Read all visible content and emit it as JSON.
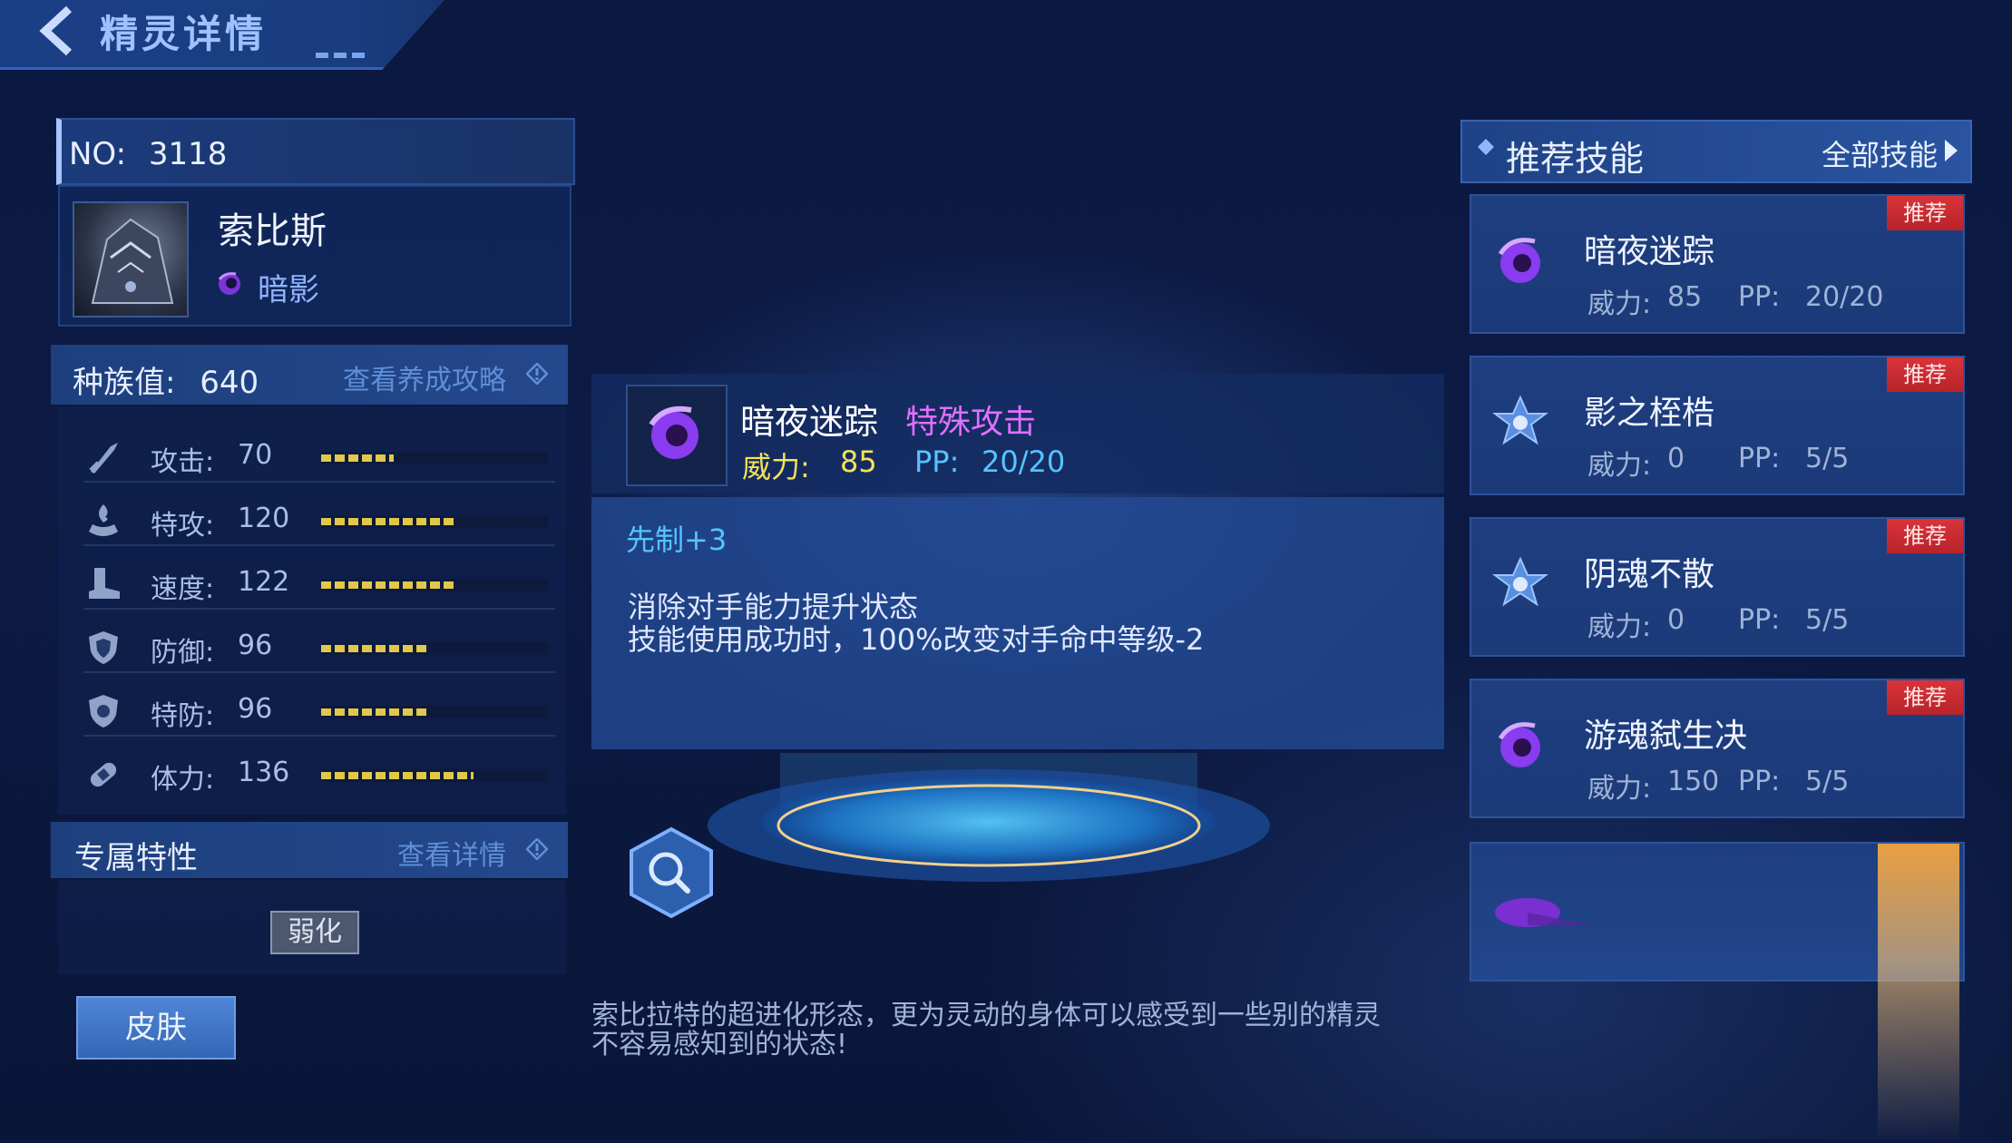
{
  "header": {
    "title": "精灵详情"
  },
  "sprite": {
    "no_label": "NO:",
    "no_value": "3118",
    "name": "索比斯",
    "type": "暗影"
  },
  "stats": {
    "total_label": "种族值:",
    "total_value": "640",
    "guide_link": "查看养成攻略",
    "items": [
      {
        "label": "攻击:",
        "value": "70",
        "fill": 0.32,
        "icon": "sword-icon"
      },
      {
        "label": "特攻:",
        "value": "120",
        "fill": 0.59,
        "icon": "fire-hand-icon"
      },
      {
        "label": "速度:",
        "value": "122",
        "fill": 0.6,
        "icon": "boot-icon"
      },
      {
        "label": "防御:",
        "value": "96",
        "fill": 0.47,
        "icon": "shield-icon"
      },
      {
        "label": "特防:",
        "value": "96",
        "fill": 0.47,
        "icon": "special-shield-icon"
      },
      {
        "label": "体力:",
        "value": "136",
        "fill": 0.67,
        "icon": "bandage-icon"
      }
    ]
  },
  "trait": {
    "title": "专属特性",
    "link": "查看详情",
    "badge": "弱化"
  },
  "skin_button": "皮肤",
  "detail": {
    "name": "暗夜迷踪",
    "category": "特殊攻击",
    "power_label": "威力:",
    "power_value": "85",
    "pp_label": "PP:",
    "pp_value": "20/20",
    "priority": "先制+3",
    "line1": "消除对手能力提升状态",
    "line2": "技能使用成功时，100%改变对手命中等级-2"
  },
  "description": {
    "line1": "索比拉特的超进化形态，更为灵动的身体可以感受到一些别的精灵",
    "line2": "不容易感知到的状态!"
  },
  "recommended": {
    "title": "推荐技能",
    "all_link": "全部技能",
    "skills": [
      {
        "name": "暗夜迷踪",
        "power_label": "威力:",
        "power": "85",
        "pp_label": "PP:",
        "pp": "20/20",
        "badge": "推荐",
        "icon": "shadow-swirl-icon"
      },
      {
        "name": "影之桎梏",
        "power_label": "威力:",
        "power": "0",
        "pp_label": "PP:",
        "pp": "5/5",
        "badge": "推荐",
        "icon": "status-star-icon"
      },
      {
        "name": "阴魂不散",
        "power_label": "威力:",
        "power": "0",
        "pp_label": "PP:",
        "pp": "5/5",
        "badge": "推荐",
        "icon": "status-star-icon"
      },
      {
        "name": "游魂弑生决",
        "power_label": "威力:",
        "power": "150",
        "pp_label": "PP:",
        "pp": "5/5",
        "badge": "推荐",
        "icon": "shadow-swirl-icon"
      }
    ]
  },
  "colors": {
    "shadow_purple": "#9b4dff",
    "power_yellow": "#f3e25a",
    "pp_cyan": "#56c4ff",
    "badge_red": "#d9343a",
    "stat_bar": "#e1c84a"
  }
}
